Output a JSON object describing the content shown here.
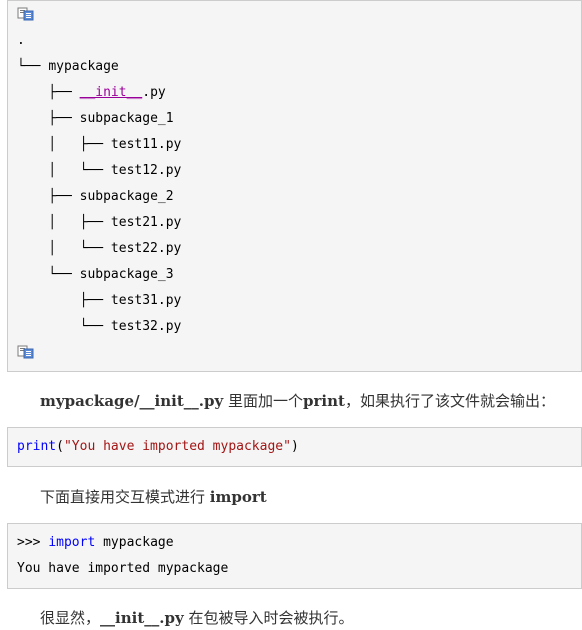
{
  "tree": {
    "lines": [
      {
        "prefix": ".",
        "name": "",
        "link": false
      },
      {
        "prefix": "└── ",
        "name": "mypackage",
        "link": false
      },
      {
        "prefix": "    ├── ",
        "name": "__init__",
        "suffix": ".py",
        "link": true
      },
      {
        "prefix": "    ├── ",
        "name": "subpackage_1",
        "link": false
      },
      {
        "prefix": "    │   ├── ",
        "name": "test11.py",
        "link": false
      },
      {
        "prefix": "    │   └── ",
        "name": "test12.py",
        "link": false
      },
      {
        "prefix": "    ├── ",
        "name": "subpackage_2",
        "link": false
      },
      {
        "prefix": "    │   ├── ",
        "name": "test21.py",
        "link": false
      },
      {
        "prefix": "    │   └── ",
        "name": "test22.py",
        "link": false
      },
      {
        "prefix": "    └── ",
        "name": "subpackage_3",
        "link": false
      },
      {
        "prefix": "        ├── ",
        "name": "test31.py",
        "link": false
      },
      {
        "prefix": "        └── ",
        "name": "test32.py",
        "link": false
      }
    ]
  },
  "para1": {
    "bold_part": "mypackage/__init__.py",
    "text_mid": " 里面加一个",
    "bold_print": "print",
    "text_end": "，如果执行了该文件就会输出："
  },
  "code1": {
    "func": "print",
    "open": "(",
    "string": "\"You have imported mypackage\"",
    "close": ")"
  },
  "para2": {
    "text": "下面直接用交互模式进行 ",
    "bold": "import"
  },
  "code2": {
    "prompt": ">>> ",
    "keyword": "import",
    "rest": " mypackage",
    "output": "You have imported mypackage"
  },
  "para3": {
    "text_start": "很显然，",
    "bold": "__init__.py",
    "text_end": " 在包被导入时会被执行。"
  },
  "icons": {
    "copy_icon_colors": [
      "#5b8bd6",
      "#7a7a7a"
    ]
  }
}
